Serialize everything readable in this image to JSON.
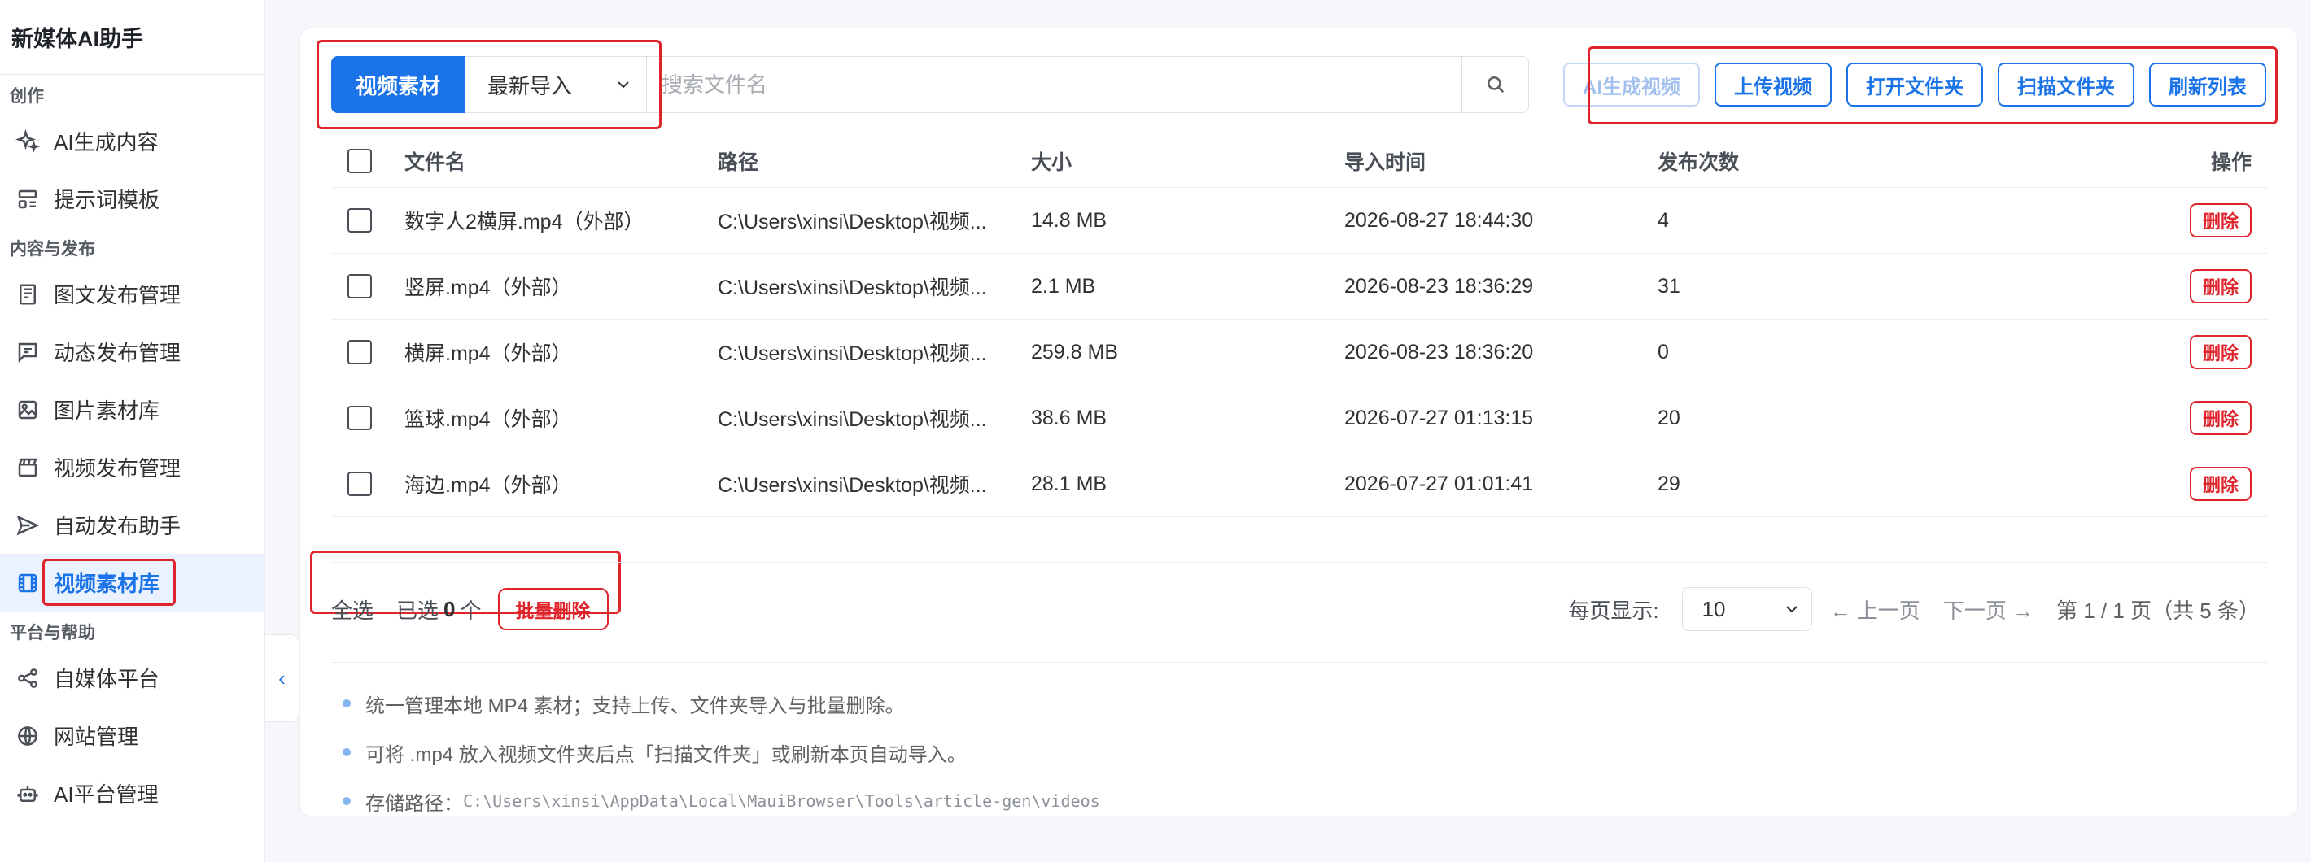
{
  "app": {
    "title": "新媒体AI助手"
  },
  "sidebar": {
    "sections": [
      {
        "title": "创作",
        "items": [
          {
            "label": "AI生成内容",
            "icon": "sparkle-icon"
          },
          {
            "label": "提示词模板",
            "icon": "template-icon"
          }
        ]
      },
      {
        "title": "内容与发布",
        "items": [
          {
            "label": "图文发布管理",
            "icon": "article-icon"
          },
          {
            "label": "动态发布管理",
            "icon": "message-icon"
          },
          {
            "label": "图片素材库",
            "icon": "image-icon"
          },
          {
            "label": "视频发布管理",
            "icon": "clapperboard-icon"
          },
          {
            "label": "自动发布助手",
            "icon": "send-icon"
          },
          {
            "label": "视频素材库",
            "icon": "film-icon",
            "active": true
          }
        ]
      },
      {
        "title": "平台与帮助",
        "items": [
          {
            "label": "自媒体平台",
            "icon": "share-icon"
          },
          {
            "label": "网站管理",
            "icon": "globe-icon"
          },
          {
            "label": "AI平台管理",
            "icon": "robot-icon"
          }
        ]
      }
    ]
  },
  "toolbar": {
    "segment_label": "视频素材",
    "sort_value": "最新导入",
    "search_placeholder": "搜索文件名",
    "buttons": {
      "ai_video": "AI生成视频",
      "upload": "上传视频",
      "open_folder": "打开文件夹",
      "scan_folder": "扫描文件夹",
      "refresh": "刷新列表"
    }
  },
  "table": {
    "columns": [
      "文件名",
      "路径",
      "大小",
      "导入时间",
      "发布次数",
      "操作"
    ],
    "rows": [
      {
        "name": "数字人2横屏.mp4（外部）",
        "path": "C:\\Users\\xinsi\\Desktop\\视频...",
        "size": "14.8 MB",
        "time": "2026-08-27 18:44:30",
        "count": "4",
        "action": "删除"
      },
      {
        "name": "竖屏.mp4（外部）",
        "path": "C:\\Users\\xinsi\\Desktop\\视频...",
        "size": "2.1 MB",
        "time": "2026-08-23 18:36:29",
        "count": "31",
        "action": "删除"
      },
      {
        "name": "横屏.mp4（外部）",
        "path": "C:\\Users\\xinsi\\Desktop\\视频...",
        "size": "259.8 MB",
        "time": "2026-08-23 18:36:20",
        "count": "0",
        "action": "删除"
      },
      {
        "name": "篮球.mp4（外部）",
        "path": "C:\\Users\\xinsi\\Desktop\\视频...",
        "size": "38.6 MB",
        "time": "2026-07-27 01:13:15",
        "count": "20",
        "action": "删除"
      },
      {
        "name": "海边.mp4（外部）",
        "path": "C:\\Users\\xinsi\\Desktop\\视频...",
        "size": "28.1 MB",
        "time": "2026-07-27 01:01:41",
        "count": "29",
        "action": "删除"
      }
    ]
  },
  "bulk": {
    "select_all": "全选",
    "selected_prefix": "已选",
    "selected_count": "0",
    "selected_suffix": "个",
    "delete_label": "批量删除"
  },
  "pager": {
    "per_page_label": "每页显示:",
    "per_page_value": "10",
    "prev": "← 上一页",
    "next": "下一页 →",
    "info": "第 1 / 1 页（共 5 条）"
  },
  "notes": {
    "line1": "统一管理本地 MP4 素材；支持上传、文件夹导入与批量删除。",
    "line2": "可将 .mp4 放入视频文件夹后点「扫描文件夹」或刷新本页自动导入。",
    "storage_label": "存储路径：",
    "storage_path": "C:\\Users\\xinsi\\AppData\\Local\\MauiBrowser\\Tools\\article-gen\\videos"
  },
  "colors": {
    "accent": "#1a73e8",
    "danger": "#e0242b",
    "highlight": "#e0242b"
  }
}
